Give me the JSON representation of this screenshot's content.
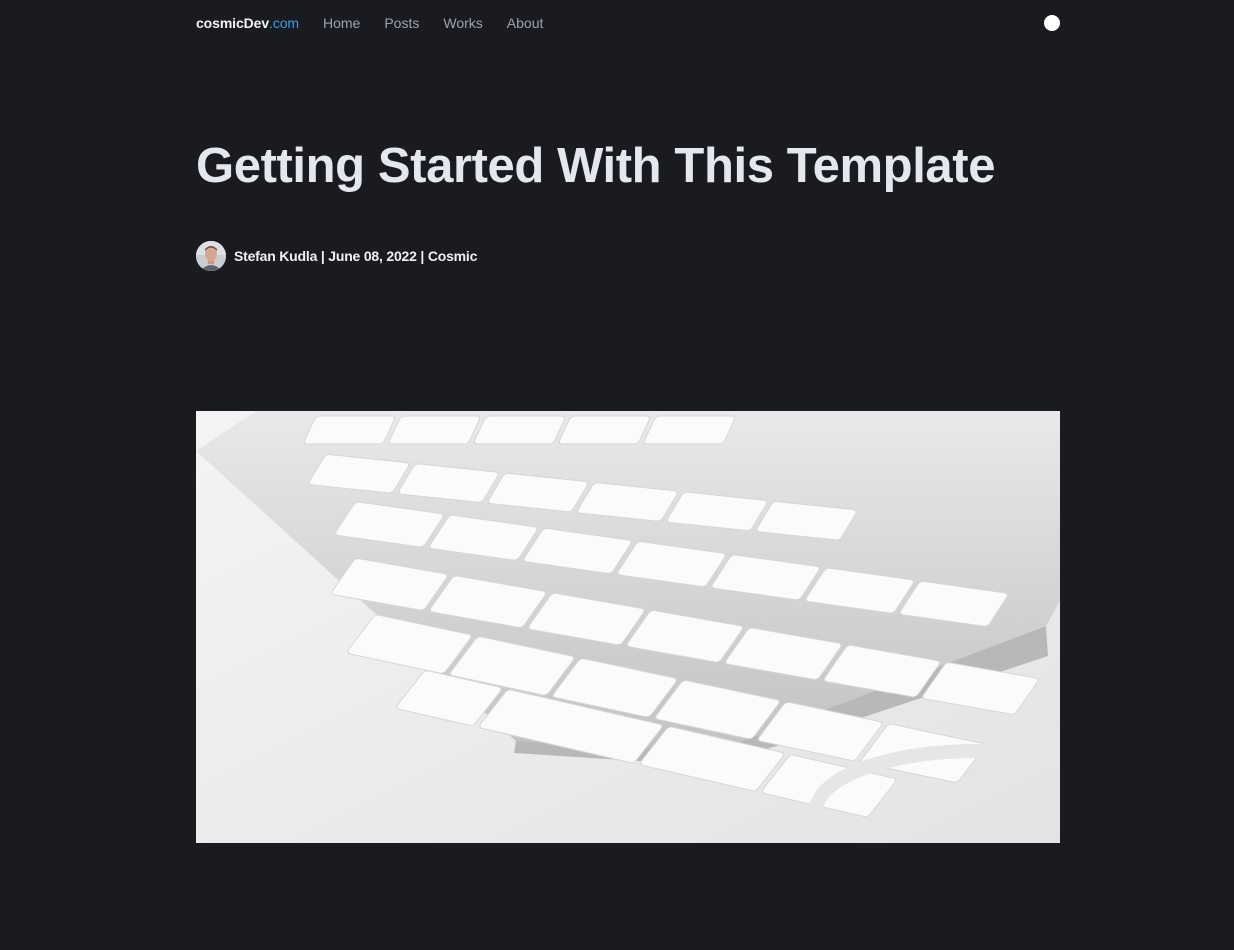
{
  "nav": {
    "brand_name": "cosmicDev",
    "brand_tld": ".com",
    "links": [
      "Home",
      "Posts",
      "Works",
      "About"
    ],
    "theme_toggle_icon": "circle-toggle-icon"
  },
  "post": {
    "title": "Getting Started With This Template",
    "author": "Stefan Kudla",
    "date": "June 08, 2022",
    "category": "Cosmic",
    "meta_line": "Stefan Kudla | June 08, 2022 | Cosmic"
  },
  "colors": {
    "background": "#1a1b20",
    "accent": "#3a9ee8",
    "title": "#e3e7ee",
    "nav_link": "#9aa3b1"
  }
}
